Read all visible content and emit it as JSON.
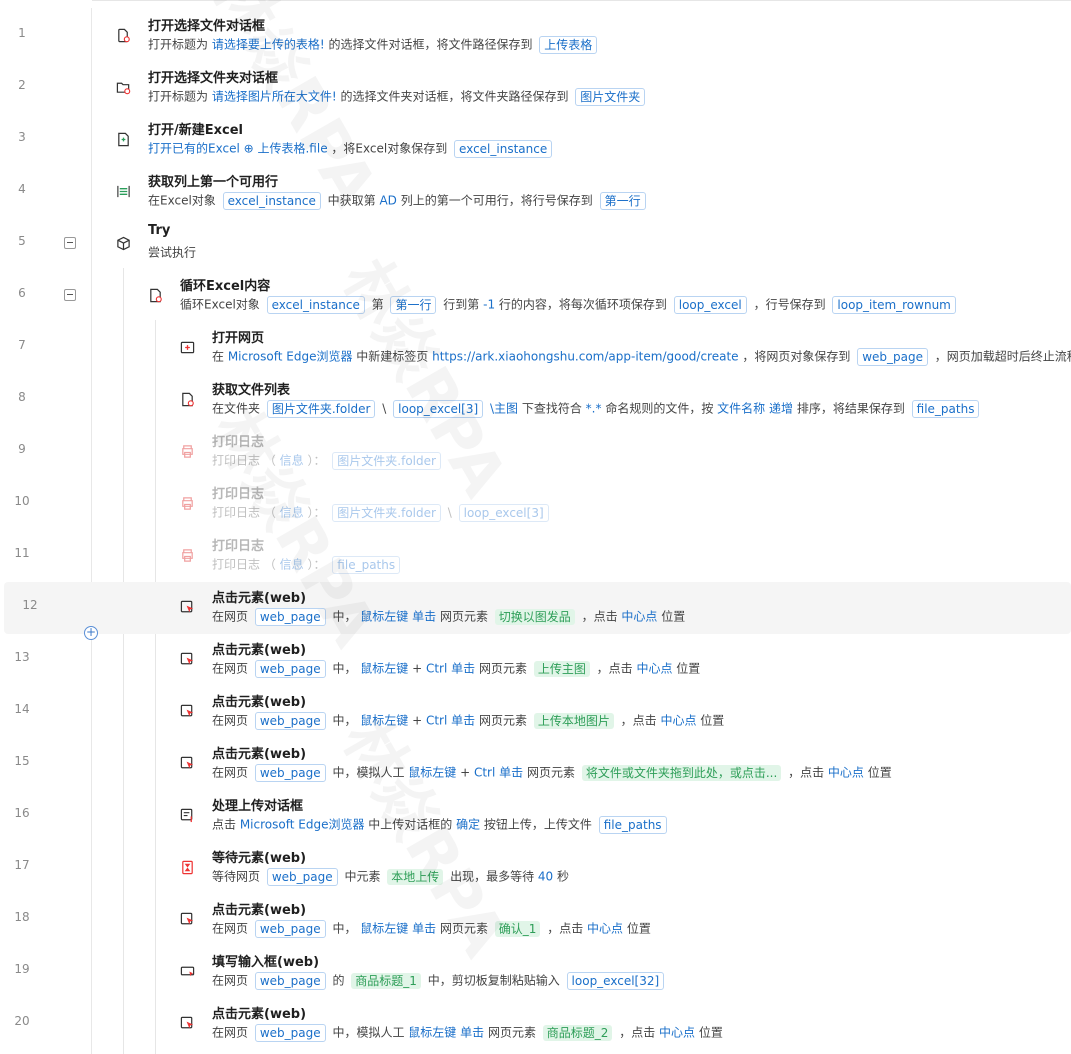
{
  "watermark": "林焱RPA",
  "add_button": "+",
  "rows": [
    {
      "n": "1",
      "title": "打开选择文件对话框",
      "icon": "open-file-dialog-icon",
      "desc": [
        [
          "t",
          "打开标题为 "
        ],
        [
          "k",
          "请选择要上传的表格!"
        ],
        [
          "t",
          "  的选择文件对话框，将文件路径保存到 "
        ],
        [
          "v",
          "上传表格"
        ]
      ]
    },
    {
      "n": "2",
      "title": "打开选择文件夹对话框",
      "icon": "open-folder-dialog-icon",
      "desc": [
        [
          "t",
          "打开标题为 "
        ],
        [
          "k",
          "请选择图片所在大文件!"
        ],
        [
          "t",
          "  的选择文件夹对话框，将文件夹路径保存到 "
        ],
        [
          "v",
          "图片文件夹"
        ]
      ]
    },
    {
      "n": "3",
      "title": "打开/新建Excel",
      "icon": "excel-icon",
      "desc": [
        [
          "k",
          "打开已有的Excel"
        ],
        [
          "t",
          "  "
        ],
        [
          "k",
          "⊕ 上传表格.file"
        ],
        [
          "t",
          " ，将Excel对象保存到 "
        ],
        [
          "v",
          "excel_instance"
        ]
      ]
    },
    {
      "n": "4",
      "title": "获取列上第一个可用行",
      "icon": "get-row-icon",
      "desc": [
        [
          "t",
          "在Excel对象 "
        ],
        [
          "v",
          "excel_instance"
        ],
        [
          "t",
          " 中获取第 "
        ],
        [
          "k",
          "AD"
        ],
        [
          "t",
          " 列上的第一个可用行，将行号保存到 "
        ],
        [
          "v",
          "第一行"
        ]
      ]
    },
    {
      "n": "5",
      "title": "Try",
      "icon": "try-cube-icon",
      "desc": [
        [
          "t",
          "尝试执行"
        ]
      ]
    },
    {
      "n": "6",
      "title": "循环Excel内容",
      "icon": "loop-excel-icon",
      "desc": [
        [
          "t",
          "循环Excel对象 "
        ],
        [
          "v",
          "excel_instance"
        ],
        [
          "t",
          " 第 "
        ],
        [
          "v",
          "第一行"
        ],
        [
          "t",
          " 行到第 "
        ],
        [
          "k",
          "-1"
        ],
        [
          "t",
          " 行的内容，将每次循环项保存到 "
        ],
        [
          "v",
          "loop_excel"
        ],
        [
          "t",
          " ，行号保存到 "
        ],
        [
          "v",
          "loop_item_rownum"
        ]
      ]
    },
    {
      "n": "7",
      "title": "打开网页",
      "icon": "open-webpage-icon",
      "desc": [
        [
          "t",
          "在 "
        ],
        [
          "k",
          "Microsoft Edge浏览器"
        ],
        [
          "t",
          " 中新建标签页 "
        ],
        [
          "k",
          "https://ark.xiaohongshu.com/app-item/good/create"
        ],
        [
          "t",
          " ，将网页对象保存到 "
        ],
        [
          "v",
          "web_page"
        ],
        [
          "t",
          " ，网页加载超时后终止流程"
        ]
      ]
    },
    {
      "n": "8",
      "title": "获取文件列表",
      "icon": "file-list-icon",
      "desc": [
        [
          "t",
          "在文件夹 "
        ],
        [
          "v",
          "图片文件夹.folder"
        ],
        [
          "t",
          " \\ "
        ],
        [
          "v",
          "loop_excel[3]"
        ],
        [
          "k",
          " \\主图"
        ],
        [
          "t",
          " 下查找符合 "
        ],
        [
          "k",
          "*.*"
        ],
        [
          "t",
          " 命名规则的文件，按 "
        ],
        [
          "k",
          "文件名称"
        ],
        [
          "t",
          " "
        ],
        [
          "k",
          "递增"
        ],
        [
          "t",
          " 排序，将结果保存到 "
        ],
        [
          "v",
          "file_paths"
        ]
      ]
    },
    {
      "n": "9",
      "title": "打印日志",
      "icon": "printer-icon",
      "disabled": true,
      "desc": [
        [
          "t",
          "打印日志 （ "
        ],
        [
          "k",
          "信息"
        ],
        [
          "t",
          " ）： "
        ],
        [
          "v",
          "图片文件夹.folder"
        ]
      ]
    },
    {
      "n": "10",
      "title": "打印日志",
      "icon": "printer-icon",
      "disabled": true,
      "desc": [
        [
          "t",
          "打印日志 （ "
        ],
        [
          "k",
          "信息"
        ],
        [
          "t",
          " ）： "
        ],
        [
          "v",
          "图片文件夹.folder"
        ],
        [
          "t",
          " \\ "
        ],
        [
          "v",
          "loop_excel[3]"
        ]
      ]
    },
    {
      "n": "11",
      "title": "打印日志",
      "icon": "printer-icon",
      "disabled": true,
      "desc": [
        [
          "t",
          "打印日志 （ "
        ],
        [
          "k",
          "信息"
        ],
        [
          "t",
          " ）： "
        ],
        [
          "v",
          "file_paths"
        ]
      ]
    },
    {
      "n": "12",
      "title": "点击元素(web)",
      "icon": "click-element-icon",
      "desc": [
        [
          "t",
          "在网页 "
        ],
        [
          "v",
          "web_page"
        ],
        [
          "t",
          " 中，  "
        ],
        [
          "k",
          "鼠标左键"
        ],
        [
          "t",
          " "
        ],
        [
          "k",
          "单击"
        ],
        [
          "t",
          " 网页元素 "
        ],
        [
          "e",
          "切换以图发品"
        ],
        [
          "t",
          " ，点击 "
        ],
        [
          "k",
          "中心点"
        ],
        [
          "t",
          " 位置"
        ]
      ]
    },
    {
      "n": "13",
      "title": "点击元素(web)",
      "icon": "click-element-icon",
      "desc": [
        [
          "t",
          "在网页 "
        ],
        [
          "v",
          "web_page"
        ],
        [
          "t",
          " 中，  "
        ],
        [
          "k",
          "鼠标左键"
        ],
        [
          "t",
          " + "
        ],
        [
          "k",
          "Ctrl"
        ],
        [
          "t",
          " "
        ],
        [
          "k",
          "单击"
        ],
        [
          "t",
          " 网页元素 "
        ],
        [
          "e",
          "上传主图"
        ],
        [
          "t",
          " ，点击 "
        ],
        [
          "k",
          "中心点"
        ],
        [
          "t",
          " 位置"
        ]
      ]
    },
    {
      "n": "14",
      "title": "点击元素(web)",
      "icon": "click-element-icon",
      "desc": [
        [
          "t",
          "在网页 "
        ],
        [
          "v",
          "web_page"
        ],
        [
          "t",
          " 中，  "
        ],
        [
          "k",
          "鼠标左键"
        ],
        [
          "t",
          " + "
        ],
        [
          "k",
          "Ctrl"
        ],
        [
          "t",
          " "
        ],
        [
          "k",
          "单击"
        ],
        [
          "t",
          " 网页元素 "
        ],
        [
          "e",
          "上传本地图片"
        ],
        [
          "t",
          " ，点击 "
        ],
        [
          "k",
          "中心点"
        ],
        [
          "t",
          " 位置"
        ]
      ]
    },
    {
      "n": "15",
      "title": "点击元素(web)",
      "icon": "click-element-icon",
      "desc": [
        [
          "t",
          "在网页 "
        ],
        [
          "v",
          "web_page"
        ],
        [
          "t",
          " 中，模拟人工 "
        ],
        [
          "k",
          "鼠标左键"
        ],
        [
          "t",
          " + "
        ],
        [
          "k",
          "Ctrl"
        ],
        [
          "t",
          " "
        ],
        [
          "k",
          "单击"
        ],
        [
          "t",
          " 网页元素 "
        ],
        [
          "e",
          "将文件或文件夹拖到此处，或点击..."
        ],
        [
          "t",
          " ，点击 "
        ],
        [
          "k",
          "中心点"
        ],
        [
          "t",
          " 位置"
        ]
      ]
    },
    {
      "n": "16",
      "title": "处理上传对话框",
      "icon": "upload-dialog-icon",
      "desc": [
        [
          "t",
          "点击 "
        ],
        [
          "k",
          "Microsoft Edge浏览器"
        ],
        [
          "t",
          " 中上传对话框的 "
        ],
        [
          "k",
          "确定"
        ],
        [
          "t",
          " 按钮上传，上传文件 "
        ],
        [
          "v",
          "file_paths"
        ]
      ]
    },
    {
      "n": "17",
      "title": "等待元素(web)",
      "icon": "hourglass-icon",
      "desc": [
        [
          "t",
          "等待网页 "
        ],
        [
          "v",
          "web_page"
        ],
        [
          "t",
          " 中元素 "
        ],
        [
          "e",
          "本地上传"
        ],
        [
          "t",
          " 出现，最多等待 "
        ],
        [
          "k",
          "40"
        ],
        [
          "t",
          " 秒"
        ]
      ]
    },
    {
      "n": "18",
      "title": "点击元素(web)",
      "icon": "click-element-icon",
      "desc": [
        [
          "t",
          "在网页 "
        ],
        [
          "v",
          "web_page"
        ],
        [
          "t",
          " 中，  "
        ],
        [
          "k",
          "鼠标左键"
        ],
        [
          "t",
          " "
        ],
        [
          "k",
          "单击"
        ],
        [
          "t",
          " 网页元素 "
        ],
        [
          "e",
          "确认_1"
        ],
        [
          "t",
          " ，点击 "
        ],
        [
          "k",
          "中心点"
        ],
        [
          "t",
          " 位置"
        ]
      ]
    },
    {
      "n": "19",
      "title": "填写输入框(web)",
      "icon": "input-box-icon",
      "desc": [
        [
          "t",
          "在网页 "
        ],
        [
          "v",
          "web_page"
        ],
        [
          "t",
          " 的 "
        ],
        [
          "e",
          "商品标题_1"
        ],
        [
          "t",
          " 中，剪切板复制粘贴输入 "
        ],
        [
          "v",
          "loop_excel[32]"
        ]
      ]
    },
    {
      "n": "20",
      "title": "点击元素(web)",
      "icon": "click-element-icon",
      "desc": [
        [
          "t",
          "在网页 "
        ],
        [
          "v",
          "web_page"
        ],
        [
          "t",
          " 中，模拟人工 "
        ],
        [
          "k",
          "鼠标左键"
        ],
        [
          "t",
          " "
        ],
        [
          "k",
          "单击"
        ],
        [
          "t",
          " 网页元素 "
        ],
        [
          "e",
          "商品标题_2"
        ],
        [
          "t",
          " ，点击 "
        ],
        [
          "k",
          "中心点"
        ],
        [
          "t",
          " 位置"
        ]
      ]
    }
  ]
}
